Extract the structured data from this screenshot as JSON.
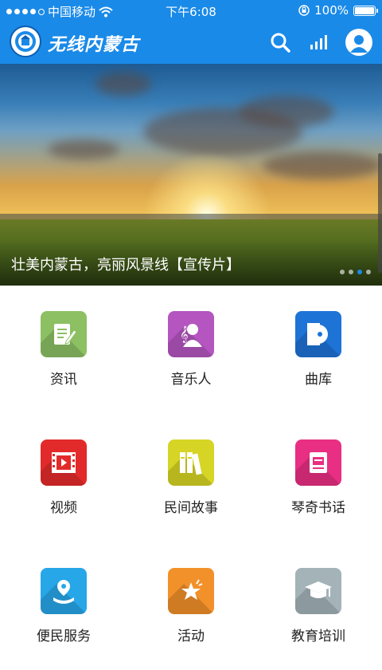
{
  "status_bar": {
    "carrier": "中国移动",
    "time": "下午6:08",
    "battery": "100%"
  },
  "header": {
    "app_title": "无线内蒙古"
  },
  "banner": {
    "caption": "壮美内蒙古，亮丽风景线【宣传片】",
    "pages": 4,
    "active_page": 3
  },
  "colors": {
    "brand_blue": "#1a8ae8"
  },
  "menu": [
    {
      "label": "资讯",
      "icon": "news-edit-icon",
      "color": "#8cc063"
    },
    {
      "label": "音乐人",
      "icon": "musician-icon",
      "color": "#b455c0"
    },
    {
      "label": "曲库",
      "icon": "music-library-icon",
      "color": "#1e73d6"
    },
    {
      "label": "视频",
      "icon": "video-icon",
      "color": "#e32a2a"
    },
    {
      "label": "民间故事",
      "icon": "folk-stories-icon",
      "color": "#d6d424"
    },
    {
      "label": "琴奇书话",
      "icon": "book-icon",
      "color": "#e82f83"
    },
    {
      "label": "便民服务",
      "icon": "location-service-icon",
      "color": "#27a6e8"
    },
    {
      "label": "活动",
      "icon": "activity-star-icon",
      "color": "#f2902a"
    },
    {
      "label": "教育培训",
      "icon": "graduation-cap-icon",
      "color": "#a3b3b8"
    }
  ]
}
